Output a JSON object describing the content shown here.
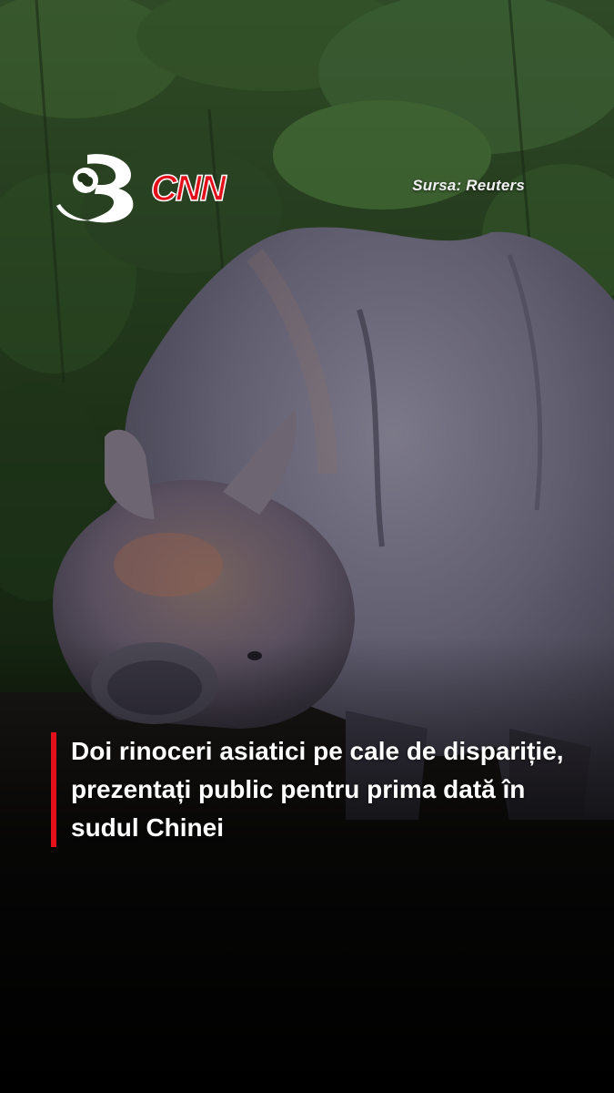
{
  "brand": {
    "channel_logo_icon": "antena3-logo-icon",
    "partner_logo_icon": "cnn-logo-icon",
    "partner_text": "CNN",
    "accent_color": "#e3101b"
  },
  "source_label": "Sursa: Reuters",
  "headline": "Doi rinoceri asiatici pe cale de dispariție, prezentați public pentru prima dată în sudul Chinei"
}
